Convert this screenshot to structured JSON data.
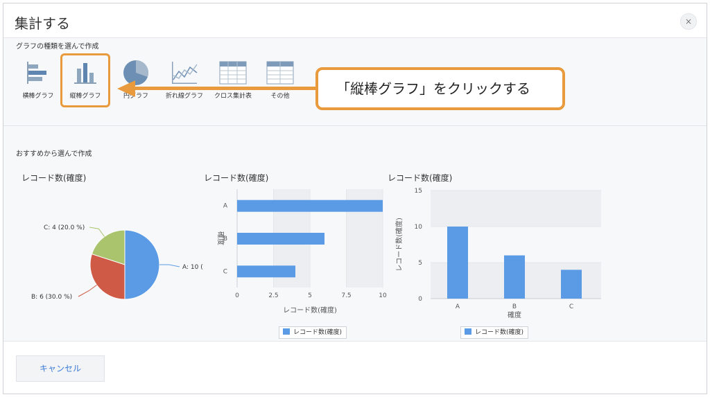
{
  "dialog": {
    "title": "集計する",
    "close_label": "×"
  },
  "chart_types": {
    "section_label": "グラフの種類を選んで作成",
    "items": [
      {
        "label": "横棒グラフ",
        "icon": "horizontal-bar-chart-icon"
      },
      {
        "label": "縦棒グラフ",
        "icon": "vertical-bar-chart-icon",
        "selected": true
      },
      {
        "label": "円グラフ",
        "icon": "pie-chart-icon"
      },
      {
        "label": "折れ線グラフ",
        "icon": "line-chart-icon"
      },
      {
        "label": "クロス集計表",
        "icon": "cross-table-icon"
      },
      {
        "label": "その他",
        "icon": "other-table-icon"
      }
    ]
  },
  "callout": {
    "text": "「縦棒グラフ」をクリックする",
    "color": "#e89a3c"
  },
  "recommend": {
    "section_label": "おすすめから選んで作成"
  },
  "colors": {
    "accent": "#5b9be6",
    "pie": [
      "#5b9be6",
      "#cf5a46",
      "#a9c46c"
    ],
    "highlight": "#e89a3c"
  },
  "chart_data": [
    {
      "type": "pie",
      "title": "レコード数(確度)",
      "categories": [
        "A",
        "B",
        "C"
      ],
      "values": [
        10,
        6,
        4
      ],
      "percent": [
        50.0,
        30.0,
        20.0
      ],
      "labels": [
        "A: 10 (",
        "B: 6 (30.0 %)",
        "C: 4 (20.0 %)"
      ]
    },
    {
      "type": "bar",
      "orientation": "horizontal",
      "title": "レコード数(確度)",
      "categories": [
        "A",
        "B",
        "C"
      ],
      "values": [
        10,
        6,
        4
      ],
      "xlabel": "レコード数(確度)",
      "ylabel": "確度",
      "xlim": [
        0,
        10
      ],
      "ticks": [
        "0",
        "2.5",
        "5",
        "7.5",
        "10"
      ],
      "tick_values": [
        0,
        2.5,
        5,
        7.5,
        10
      ],
      "legend": "レコード数(確度)"
    },
    {
      "type": "bar",
      "orientation": "vertical",
      "title": "レコード数(確度)",
      "categories": [
        "A",
        "B",
        "C"
      ],
      "values": [
        10,
        6,
        4
      ],
      "xlabel": "確度",
      "ylabel": "レコード数(確度)",
      "ylim": [
        0,
        15
      ],
      "ticks": [
        "0",
        "5",
        "10",
        "15"
      ],
      "tick_values": [
        0,
        5,
        10,
        15
      ],
      "legend": "レコード数(確度)"
    }
  ],
  "footer": {
    "cancel_label": "キャンセル"
  }
}
